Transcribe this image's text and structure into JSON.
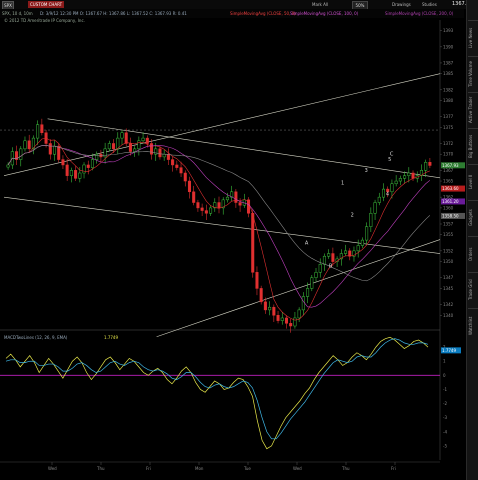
{
  "toolbar": {
    "symbol": "SPX",
    "status_tag": "CUSTOM CHART",
    "search_label": "Mark All",
    "zoom_label": "50%",
    "drawings_label": "Drawings",
    "studies_label": "Studies",
    "price_readout": "1367.93"
  },
  "infobar": {
    "timeframe": "SPX, 10 d, 10m",
    "ohlc": "D: 3/9/12 12:30 PM  O: 1367.67  H: 1367.86  L: 1367.52  C: 1367.93  R: 0.41",
    "studies": [
      "SimpleMovingAvg (CLOSE, 50, 0)",
      "SimpleMovingAvg (CLOSE, 100, 0)",
      "SimpleMovingAvg (CLOSE, 200, 0)"
    ]
  },
  "copyright": "© 2012 TD Ameritrade IP Company, Inc.",
  "macd_label": "MACDTwoLines (12, 26, 9, EMA)",
  "macd_value": "1.7749",
  "side_tabs": [
    "Live News",
    "Time Volume",
    "Active Trader",
    "Big Buttons",
    "Level II",
    "Gadgets",
    "Orders",
    "Trade Grid",
    "Watchlist"
  ],
  "chart_data": [
    {
      "type": "candlestick",
      "x_ticks": [
        "Wed",
        "Thu",
        "Fri",
        "Mon",
        "Tue",
        "Wed",
        "Thu",
        "Fri"
      ],
      "y_ticks": [
        1393,
        1390,
        1387,
        1385,
        1382,
        1380,
        1377,
        1375,
        1372,
        1370,
        1367,
        1365,
        1362,
        1360,
        1357,
        1355,
        1352,
        1350,
        1347,
        1345,
        1342,
        1340
      ],
      "ylim": [
        1338,
        1395
      ],
      "price_tags": [
        {
          "value": "1367.93",
          "color": "#2e7d32"
        },
        {
          "value": "1363.60",
          "color": "#b71c1c"
        },
        {
          "value": "1361.20",
          "color": "#6a1b9a"
        },
        {
          "value": "1358.50",
          "color": "#555555"
        }
      ],
      "wave_labels": [
        {
          "text": "A",
          "t": 0.69,
          "y": 1353.2
        },
        {
          "text": "B",
          "t": 0.745,
          "y": 1348.9
        },
        {
          "text": "1",
          "t": 0.773,
          "y": 1364.4
        },
        {
          "text": "2",
          "t": 0.795,
          "y": 1358.4
        },
        {
          "text": "3",
          "t": 0.827,
          "y": 1366.7
        },
        {
          "text": "4",
          "t": 0.876,
          "y": 1362.3
        },
        {
          "text": "5",
          "t": 0.881,
          "y": 1368.7
        },
        {
          "text": "C",
          "t": 0.885,
          "y": 1369.8
        }
      ],
      "trendlines": [
        {
          "t1": 0.0,
          "y1": 1366.0,
          "t2": 1.0,
          "y2": 1385.0
        },
        {
          "t1": 0.1,
          "y1": 1376.6,
          "t2": 1.0,
          "y2": 1365.6
        },
        {
          "t1": 0.0,
          "y1": 1362.0,
          "t2": 1.0,
          "y2": 1351.5
        },
        {
          "t1": 0.35,
          "y1": 1336.0,
          "t2": 1.0,
          "y2": 1354.1
        }
      ],
      "hline": 1374.5,
      "close": [
        1368,
        1370.5,
        1369,
        1371,
        1372.5,
        1371,
        1373,
        1375.5,
        1374,
        1372,
        1370,
        1371.5,
        1369,
        1368,
        1366,
        1367,
        1365.5,
        1366.5,
        1368,
        1367.5,
        1369,
        1370,
        1369.5,
        1371,
        1372,
        1371,
        1373,
        1374,
        1372,
        1370.5,
        1371,
        1372.5,
        1373,
        1372,
        1370,
        1371,
        1369.5,
        1370,
        1369,
        1368,
        1367.5,
        1366.5,
        1365,
        1363,
        1361,
        1360,
        1359.5,
        1359,
        1360,
        1361,
        1360,
        1361.5,
        1362,
        1363,
        1361,
        1360.5,
        1361.5,
        1359,
        1348,
        1345,
        1342.5,
        1341,
        1341.5,
        1340,
        1339,
        1339.5,
        1338.5,
        1338,
        1339.5,
        1341,
        1343.5,
        1345,
        1347,
        1348,
        1349.5,
        1351,
        1351.5,
        1350,
        1350.5,
        1351.5,
        1352,
        1351,
        1352,
        1353,
        1354,
        1356.5,
        1359,
        1361,
        1362,
        1363.5,
        1363,
        1364.5,
        1365,
        1365.5,
        1366,
        1366.5,
        1365.5,
        1366,
        1367,
        1368.5,
        1367.9
      ]
    },
    {
      "type": "line",
      "title": "MACDTwoLines (12, 26, 9, EMA)",
      "ylim": [
        -6,
        3
      ],
      "y_ticks": [
        2,
        1,
        0,
        -1,
        -2,
        -3,
        -4,
        -5
      ],
      "zero_line": 0,
      "series": [
        {
          "color": "#e8e84a",
          "values": [
            1.2,
            1.5,
            1.1,
            0.6,
            1.0,
            1.4,
            0.9,
            0.2,
            0.7,
            1.2,
            0.8,
            0.3,
            -0.2,
            0.4,
            1.0,
            1.3,
            0.9,
            0.2,
            -0.3,
            0.1,
            0.6,
            1.1,
            1.3,
            0.9,
            0.4,
            0.8,
            1.2,
            1.0,
            0.6,
            0.2,
            0.0,
            0.3,
            0.5,
            0.2,
            -0.3,
            -0.6,
            -0.2,
            0.3,
            0.6,
            0.2,
            -0.5,
            -1.0,
            -1.2,
            -0.8,
            -0.4,
            -0.6,
            -1.0,
            -0.9,
            -0.5,
            -0.2,
            -0.3,
            -0.8,
            -1.5,
            -3.2,
            -4.6,
            -5.2,
            -5.0,
            -4.3,
            -3.6,
            -3.0,
            -2.6,
            -2.2,
            -1.8,
            -1.3,
            -0.9,
            -0.3,
            0.2,
            0.6,
            1.0,
            1.4,
            1.1,
            0.7,
            0.9,
            1.3,
            1.6,
            1.4,
            1.1,
            1.5,
            2.0,
            2.4,
            2.6,
            2.7,
            2.5,
            2.2,
            1.9,
            2.1,
            2.4,
            2.5,
            2.3,
            2.0
          ]
        },
        {
          "color": "#3fb8e8",
          "values": [
            1.0,
            1.1,
            1.1,
            0.9,
            0.9,
            1.0,
            1.0,
            0.7,
            0.7,
            0.8,
            0.8,
            0.6,
            0.3,
            0.3,
            0.5,
            0.8,
            0.9,
            0.7,
            0.4,
            0.2,
            0.3,
            0.6,
            0.9,
            1.0,
            0.8,
            0.7,
            0.9,
            1.0,
            0.9,
            0.6,
            0.4,
            0.3,
            0.4,
            0.3,
            0.1,
            -0.2,
            -0.3,
            -0.1,
            0.2,
            0.2,
            -0.1,
            -0.5,
            -0.8,
            -0.9,
            -0.7,
            -0.6,
            -0.8,
            -0.9,
            -0.8,
            -0.6,
            -0.4,
            -0.5,
            -0.9,
            -1.8,
            -3.0,
            -4.0,
            -4.5,
            -4.5,
            -4.1,
            -3.6,
            -3.1,
            -2.7,
            -2.3,
            -1.9,
            -1.4,
            -0.9,
            -0.4,
            0.1,
            0.5,
            0.9,
            1.1,
            1.0,
            0.9,
            1.0,
            1.3,
            1.4,
            1.3,
            1.3,
            1.6,
            2.0,
            2.3,
            2.5,
            2.6,
            2.5,
            2.3,
            2.2,
            2.2,
            2.3,
            2.3,
            2.2
          ]
        }
      ]
    }
  ]
}
